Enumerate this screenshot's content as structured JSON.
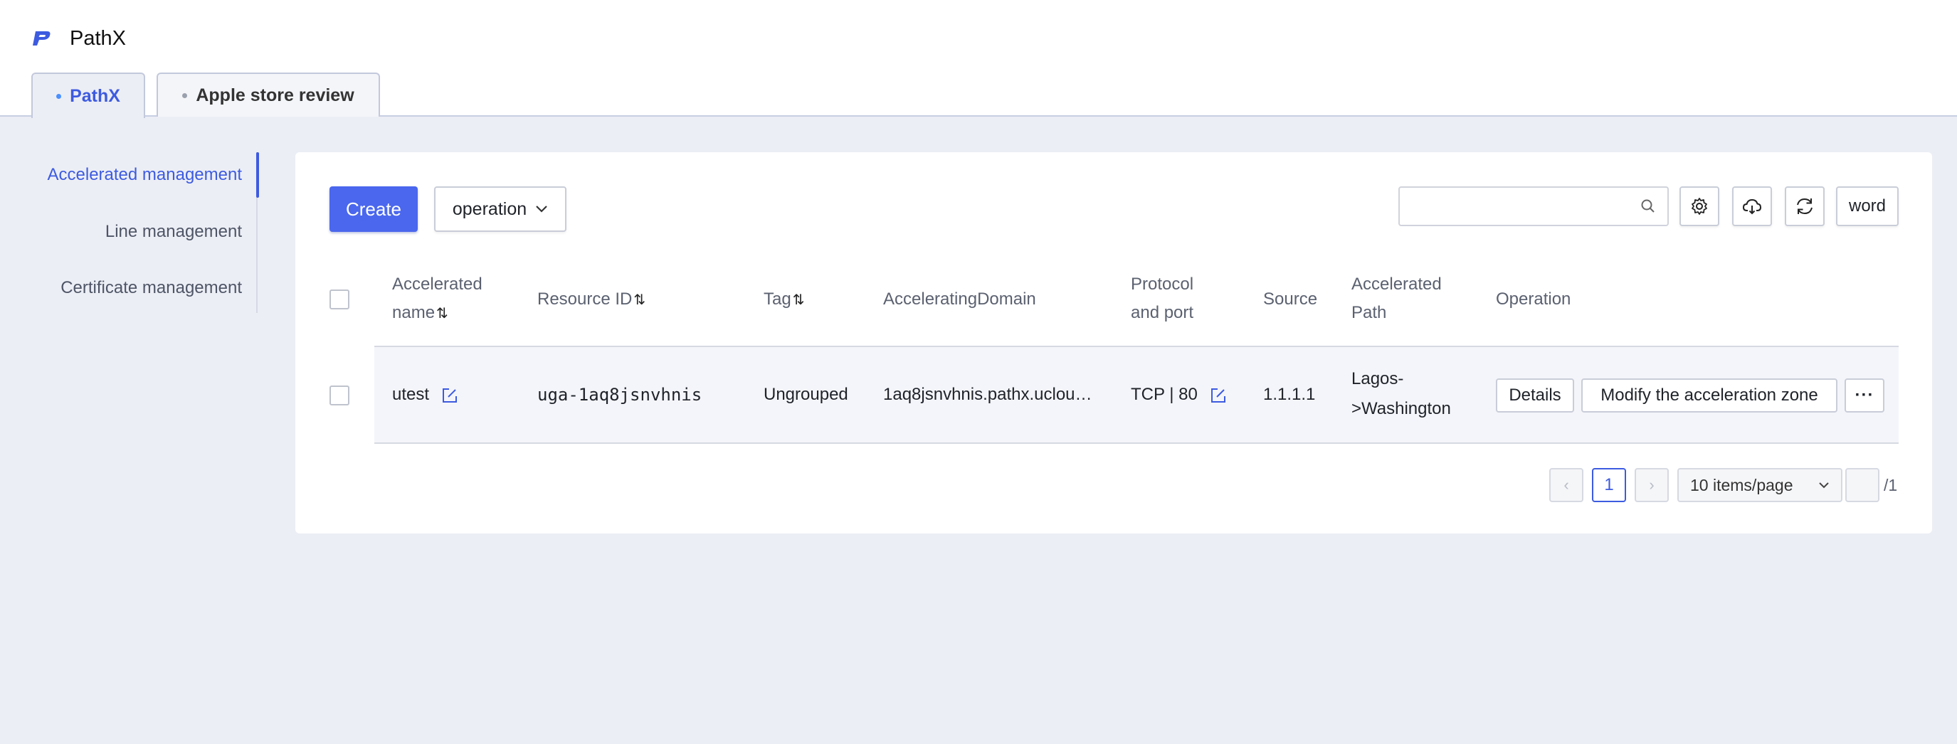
{
  "brand": {
    "name": "PathX"
  },
  "tabs": [
    {
      "label": "PathX",
      "active": true
    },
    {
      "label": "Apple store review",
      "active": false
    }
  ],
  "sidebar": {
    "items": [
      {
        "label": "Accelerated management",
        "active": true
      },
      {
        "label": "Line management",
        "active": false
      },
      {
        "label": "Certificate management",
        "active": false
      }
    ]
  },
  "toolbar": {
    "create_label": "Create",
    "operation_label": "operation",
    "search_value": "",
    "word_label": "word"
  },
  "table": {
    "columns": [
      {
        "line1": "Accelerated",
        "line2": "name",
        "sortable": true
      },
      {
        "label": "Resource ID",
        "sortable": true
      },
      {
        "label": "Tag",
        "sortable": true
      },
      {
        "label": "AcceleratingDomain"
      },
      {
        "line1": "Protocol",
        "line2": "and port"
      },
      {
        "label": "Source"
      },
      {
        "line1": "Accelerated",
        "line2": "Path"
      },
      {
        "label": "Operation"
      }
    ],
    "sort_glyph": "⇅",
    "rows": [
      {
        "name": "utest",
        "resource_id": "uga-1aq8jsnvhnis",
        "tag": "Ungrouped",
        "domain": "1aq8jsnvhnis.pathx.uclou…",
        "protocol_port": "TCP | 80",
        "source": "1.1.1.1",
        "path_line1": "Lagos-",
        "path_line2": ">Washington",
        "details_label": "Details",
        "modify_label": "Modify the acceleration zone",
        "more_label": "···"
      }
    ]
  },
  "pagination": {
    "prev": "‹",
    "current": "1",
    "next": "›",
    "page_size": "10 items/page",
    "jump_value": "",
    "total": "/1"
  },
  "colors": {
    "accent": "#3d5be0",
    "create_button": "#4a67ee",
    "background": "#eceef5"
  }
}
